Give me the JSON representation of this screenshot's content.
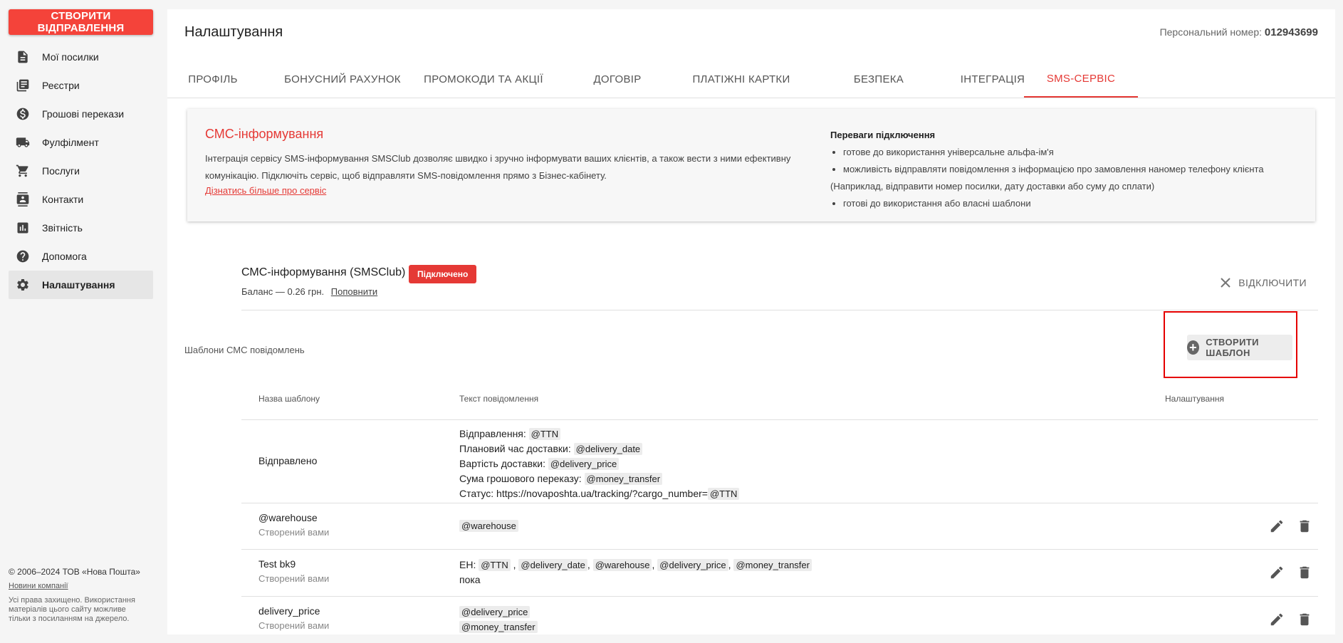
{
  "sidebar": {
    "create_label": "СТВОРИТИ ВІДПРАВЛЕННЯ",
    "items": [
      {
        "label": "Мої посилки",
        "icon": "document-icon"
      },
      {
        "label": "Реєстри",
        "icon": "registry-icon"
      },
      {
        "label": "Грошові перекази",
        "icon": "money-icon"
      },
      {
        "label": "Фулфілмент",
        "icon": "truck-icon"
      },
      {
        "label": "Послуги",
        "icon": "cart-icon"
      },
      {
        "label": "Контакти",
        "icon": "contacts-icon"
      },
      {
        "label": "Звітність",
        "icon": "chart-icon"
      },
      {
        "label": "Допомога",
        "icon": "help-icon"
      },
      {
        "label": "Налаштування",
        "icon": "gear-icon"
      }
    ],
    "footer": {
      "copyright": "© 2006–2024 ТОВ «Нова Пошта»",
      "news": "Новини компанії",
      "rights": "Усі права захищено. Використання матеріалів цього сайту можливе тільки з посиланням на джерело."
    }
  },
  "header": {
    "title": "Налаштування",
    "personal_label": "Персональний номер:",
    "personal_number": "012943699"
  },
  "tabs": [
    "ПРОФІЛЬ",
    "БОНУСНИЙ РАХУНОК",
    "ПРОМОКОДИ ТА АКЦІЇ",
    "ДОГОВІР",
    "ПЛАТІЖНІ КАРТКИ",
    "БЕЗПЕКА",
    "ІНТЕГРАЦІЯ",
    "SMS-СЕРВІС"
  ],
  "info": {
    "title": "СМС-інформування",
    "description": "Інтеграція сервісу SMS-інформування SMSClub дозволяє швидко і зручно інформувати ваших клієнтів, а також вести з ними ефективну комунікацію. Підключіть сервіс, щоб відправляти SMS-повідомлення прямо з Бізнес-кабінету.",
    "link": "Дізнатись більше про сервіс",
    "advantages_title": "Переваги підключення",
    "adv1": "готове до використання універсальне альфа-ім'я",
    "adv2": "можливість відправляти повідомлення з інформацією про замовлення наномер телефону клієнта",
    "adv2_note": "(Наприклад, відправити номер посилки, дату доставки або суму до сплати)",
    "adv3": "готові до використання або власні шаблони"
  },
  "service": {
    "name": "СМС-інформування (SMSClub)",
    "status": "Підключено",
    "balance": "Баланс — 0.26 грн.",
    "topup": "Поповнити",
    "disconnect": "ВІДКЛЮЧИТИ"
  },
  "templates": {
    "label": "Шаблони СМС повідомлень",
    "create": "СТВОРИТИ ШАБЛОН",
    "columns": {
      "name": "Назва шаблону",
      "text": "Текст повідомлення",
      "settings": "Налаштування"
    },
    "created_by_you": "Створений вами",
    "row1": {
      "name": "Відправлено",
      "l1": "Відправлення:",
      "l1c": "@TTN",
      "l2": "Плановий час доставки:",
      "l2c": "@delivery_date",
      "l3": "Вартість доставки:",
      "l3c": "@delivery_price",
      "l4": "Сума грошового переказу:",
      "l4c": "@money_transfer",
      "l5": "Статус: https://novaposhta.ua/tracking/?cargo_number=",
      "l5c": "@TTN"
    },
    "row2": {
      "name": "@warehouse",
      "c1": "@warehouse"
    },
    "row3": {
      "name": "Test bk9",
      "prefix": "ЕН:",
      "c1": "@TTN",
      "c2": "@delivery_date",
      "c3": "@warehouse",
      "c4": "@delivery_price",
      "c5": "@money_transfer",
      "line2": "пока"
    },
    "row4": {
      "name": "delivery_price",
      "c1": "@delivery_price",
      "c2": "@money_transfer"
    }
  }
}
